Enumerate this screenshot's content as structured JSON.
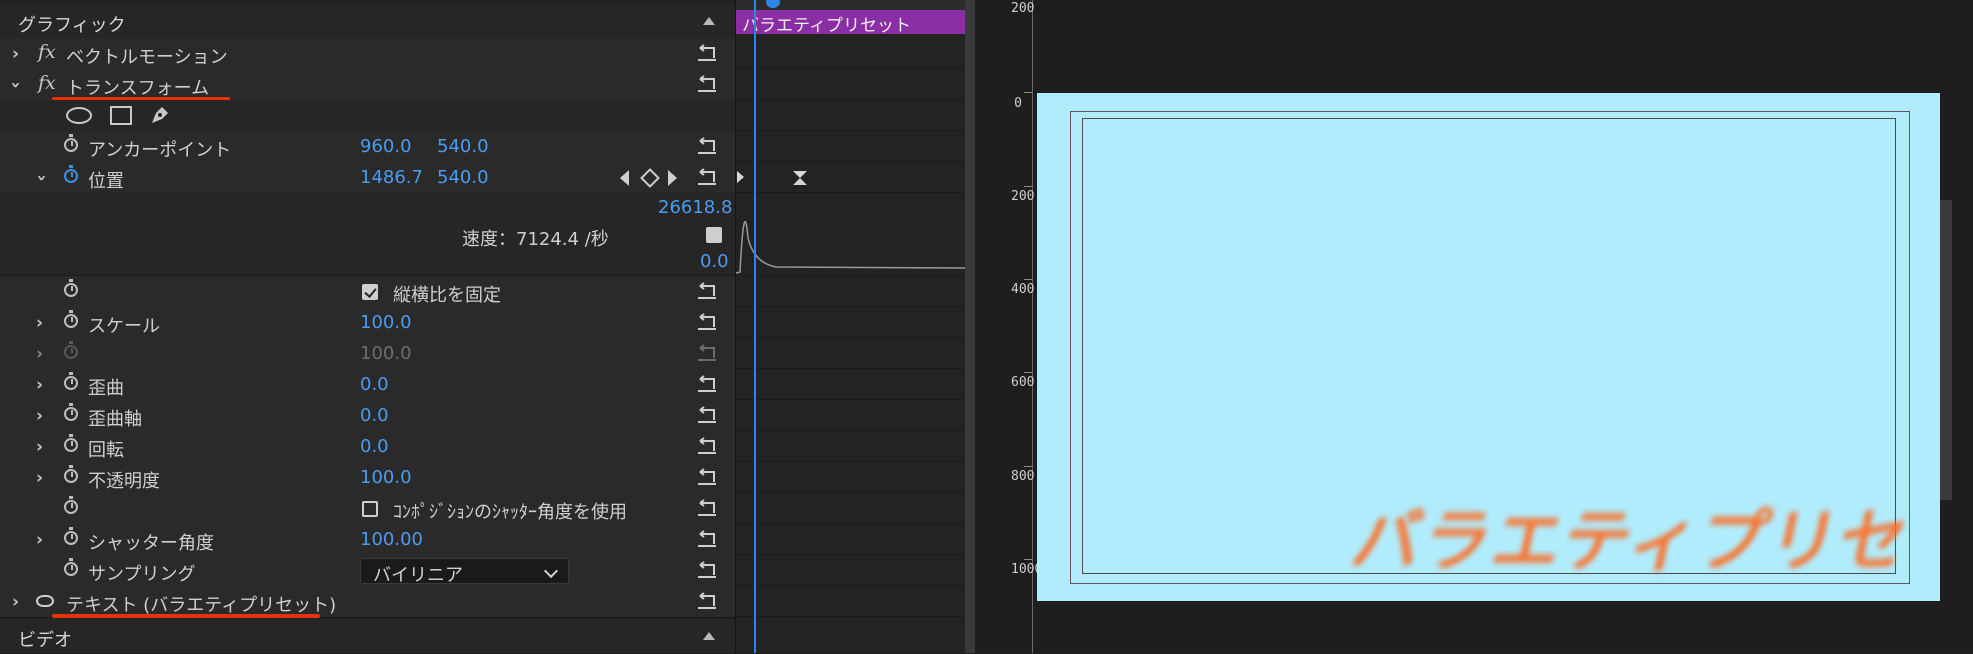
{
  "effect_controls": {
    "graphic_header": "グラフィック",
    "vector_motion": "ベクトルモーション",
    "transform": "トランスフォーム",
    "anchor_point": {
      "label": "アンカーポイント",
      "x": "960.0",
      "y": "540.0"
    },
    "position": {
      "label": "位置",
      "x": "1486.7",
      "y": "540.0"
    },
    "velocity_graph": {
      "max": "26618.8",
      "speed": "速度：7124.4 /秒",
      "min": "0.0"
    },
    "uniform_scale": {
      "label": "縦横比を固定",
      "checked": true
    },
    "scale": {
      "label": "スケール",
      "value": "100.0"
    },
    "scale_width": {
      "value": "100.0"
    },
    "skew": {
      "label": "歪曲",
      "value": "0.0"
    },
    "skew_axis": {
      "label": "歪曲軸",
      "value": "0.0"
    },
    "rotation": {
      "label": "回転",
      "value": "0.0"
    },
    "opacity": {
      "label": "不透明度",
      "value": "100.0"
    },
    "comp_shutter": {
      "label": "ｺﾝﾎﾟｼﾞｼｮﾝのｼｬｯﾀｰ角度を使用",
      "checked": false
    },
    "shutter_angle": {
      "label": "シャッター角度",
      "value": "100.00"
    },
    "sampling": {
      "label": "サンプリング",
      "value": "バイリニア"
    },
    "text_layer": "テキスト (バラエティプリセット)",
    "video_header": "ビデオ"
  },
  "timeline": {
    "clip_label": "バラエティプリセット"
  },
  "monitor": {
    "ruler_labels": [
      "200",
      "0",
      "200",
      "400",
      "600",
      "800",
      "1000"
    ],
    "canvas_text": "バラエティプリセ",
    "canvas_color": "#b0ecfc",
    "text_color": "#ff6a1e"
  },
  "colors": {
    "accent_blue": "#4a9cf0",
    "clip_purple": "#8a2ea4",
    "annotation_red": "#e8320e"
  }
}
